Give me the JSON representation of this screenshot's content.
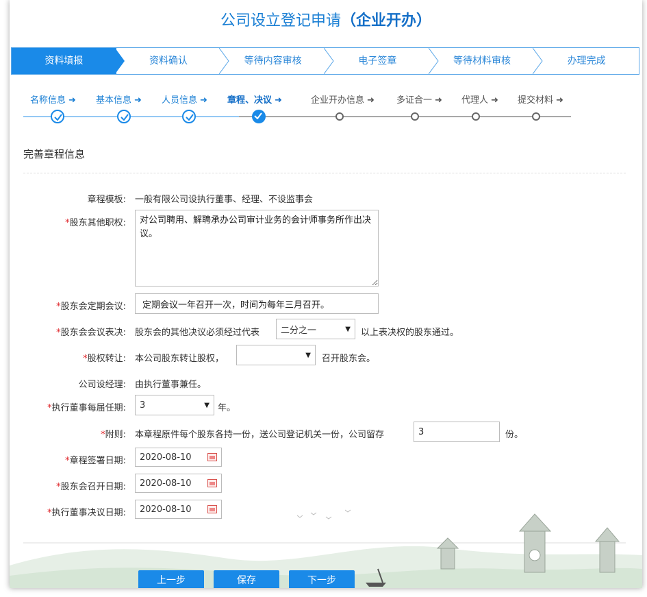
{
  "page": {
    "title_main": "公司设立登记申请",
    "title_paren": "（企业开办）"
  },
  "main_steps": [
    {
      "label": "资料填报",
      "active": true
    },
    {
      "label": "资料确认",
      "active": false
    },
    {
      "label": "等待内容审核",
      "active": false
    },
    {
      "label": "电子签章",
      "active": false
    },
    {
      "label": "等待材料审核",
      "active": false
    },
    {
      "label": "办理完成",
      "active": false
    }
  ],
  "sub_steps": [
    {
      "label": "名称信息",
      "state": "done"
    },
    {
      "label": "基本信息",
      "state": "done"
    },
    {
      "label": "人员信息",
      "state": "done"
    },
    {
      "label": "章程、决议",
      "state": "current"
    },
    {
      "label": "企业开办信息",
      "state": "todo"
    },
    {
      "label": "多证合一",
      "state": "todo"
    },
    {
      "label": "代理人",
      "state": "todo"
    },
    {
      "label": "提交材料",
      "state": "todo"
    }
  ],
  "arrow_glyph": "➜",
  "section_title": "完善章程信息",
  "form": {
    "template": {
      "label": "章程模板:",
      "value": "一般有限公司设执行董事、经理、不设监事会"
    },
    "other_powers": {
      "req": "*",
      "label": "股东其他职权:",
      "value": "对公司聘用、解聘承办公司审计业务的会计师事务所作出决议。"
    },
    "regular_meeting": {
      "req": "*",
      "label": "股东会定期会议:",
      "value": "定期会议一年召开一次，时间为每年三月召开。"
    },
    "meeting_vote": {
      "req": "*",
      "label": "股东会会议表决:",
      "prefix": "股东会的其他决议必须经过代表",
      "selected": "二分之一",
      "suffix": "以上表决权的股东通过。"
    },
    "equity_transfer": {
      "req": "*",
      "label": "股权转让:",
      "prefix": "本公司股东转让股权，",
      "selected": "",
      "suffix": "召开股东会。"
    },
    "manager": {
      "label": "公司设经理:",
      "value": "由执行董事兼任。"
    },
    "director_term": {
      "req": "*",
      "label": "执行董事每届任期:",
      "selected": "3",
      "suffix": "年。"
    },
    "appendix": {
      "req": "*",
      "label": "附则:",
      "prefix": "本章程原件每个股东各持一份，送公司登记机关一份，公司留存",
      "value": "3",
      "suffix": "份。"
    },
    "charter_sign_date": {
      "req": "*",
      "label": "章程签署日期:",
      "value": "2020-08-10"
    },
    "meeting_date": {
      "req": "*",
      "label": "股东会召开日期:",
      "value": "2020-08-10"
    },
    "resolution_date": {
      "req": "*",
      "label": "执行董事决议日期:",
      "value": "2020-08-10"
    }
  },
  "buttons": {
    "prev": "上一步",
    "save": "保存",
    "next": "下一步"
  },
  "colors": {
    "accent": "#1a8ae8",
    "required": "#e0262a"
  }
}
